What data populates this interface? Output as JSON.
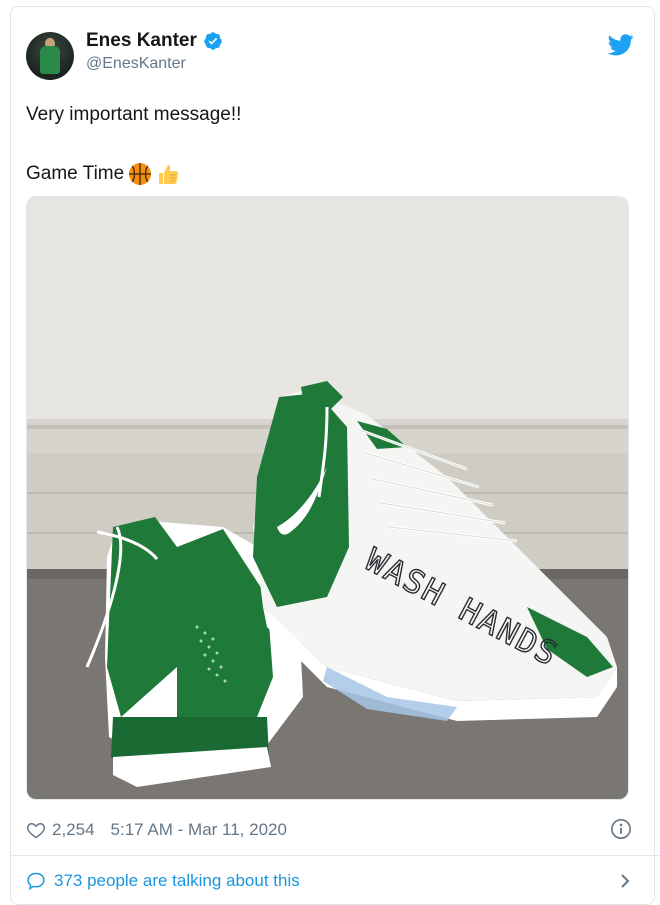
{
  "tweet": {
    "display_name": "Enes Kanter",
    "handle": "@EnesKanter",
    "text_line1": "Very important message!!",
    "text_line2": "Game Time",
    "emojis": [
      "basketball-emoji",
      "thumbs-up-emoji"
    ],
    "shoe_text": "WASH HANDS",
    "likes": "2,254",
    "timestamp": "5:17 AM - Mar 11, 2020",
    "talking": "373 people are talking about this"
  },
  "icons": {
    "verified": "verified-badge-icon",
    "brand": "twitter-bird-icon",
    "like": "heart-icon",
    "info": "info-icon",
    "reply": "speech-bubble-icon",
    "chevron": "chevron-right-icon"
  },
  "colors": {
    "link": "#1b95e0",
    "muted": "#657786",
    "text": "#14171a",
    "shoe_green": "#1f7a3a"
  }
}
